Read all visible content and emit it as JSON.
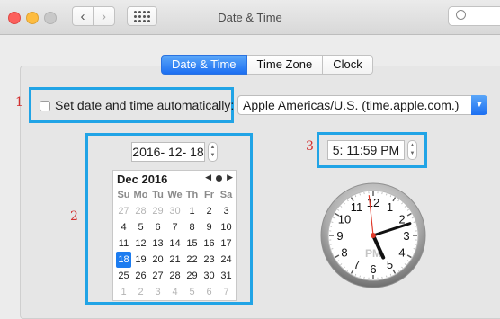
{
  "window": {
    "title": "Date & Time"
  },
  "tabs": [
    {
      "label": "Date & Time",
      "active": true
    },
    {
      "label": "Time Zone",
      "active": false
    },
    {
      "label": "Clock",
      "active": false
    }
  ],
  "annotations": [
    "1",
    "2",
    "3"
  ],
  "auto": {
    "label": "Set date and time automatically:",
    "checked": false,
    "server": "Apple Americas/U.S. (time.apple.com.)"
  },
  "date": {
    "value": "2016- 12- 18",
    "month_label": "Dec 2016",
    "weekdays": [
      "Su",
      "Mo",
      "Tu",
      "We",
      "Th",
      "Fr",
      "Sa"
    ],
    "days": [
      {
        "d": "27",
        "m": true
      },
      {
        "d": "28",
        "m": true
      },
      {
        "d": "29",
        "m": true
      },
      {
        "d": "30",
        "m": true
      },
      {
        "d": "1"
      },
      {
        "d": "2"
      },
      {
        "d": "3"
      },
      {
        "d": "4"
      },
      {
        "d": "5"
      },
      {
        "d": "6"
      },
      {
        "d": "7"
      },
      {
        "d": "8"
      },
      {
        "d": "9"
      },
      {
        "d": "10"
      },
      {
        "d": "11"
      },
      {
        "d": "12"
      },
      {
        "d": "13"
      },
      {
        "d": "14"
      },
      {
        "d": "15"
      },
      {
        "d": "16"
      },
      {
        "d": "17"
      },
      {
        "d": "18",
        "sel": true
      },
      {
        "d": "19"
      },
      {
        "d": "20"
      },
      {
        "d": "21"
      },
      {
        "d": "22"
      },
      {
        "d": "23"
      },
      {
        "d": "24"
      },
      {
        "d": "25"
      },
      {
        "d": "26"
      },
      {
        "d": "27"
      },
      {
        "d": "28"
      },
      {
        "d": "29"
      },
      {
        "d": "30"
      },
      {
        "d": "31"
      },
      {
        "d": "1",
        "m": true
      },
      {
        "d": "2",
        "m": true
      },
      {
        "d": "3",
        "m": true
      },
      {
        "d": "4",
        "m": true
      },
      {
        "d": "5",
        "m": true
      },
      {
        "d": "6",
        "m": true
      },
      {
        "d": "7",
        "m": true
      }
    ]
  },
  "time": {
    "value": "5: 11:59 PM",
    "clock_numerals": [
      "12",
      "1",
      "2",
      "3",
      "4",
      "5",
      "6",
      "7",
      "8",
      "9",
      "10",
      "11"
    ],
    "meridiem": "PM",
    "hour": 5,
    "minute": 11,
    "second": 59
  },
  "colors": {
    "highlight": "#21a4e6",
    "accent": "#1c7cf0",
    "annotation": "#d23030",
    "second_hand": "#e03a2a"
  }
}
